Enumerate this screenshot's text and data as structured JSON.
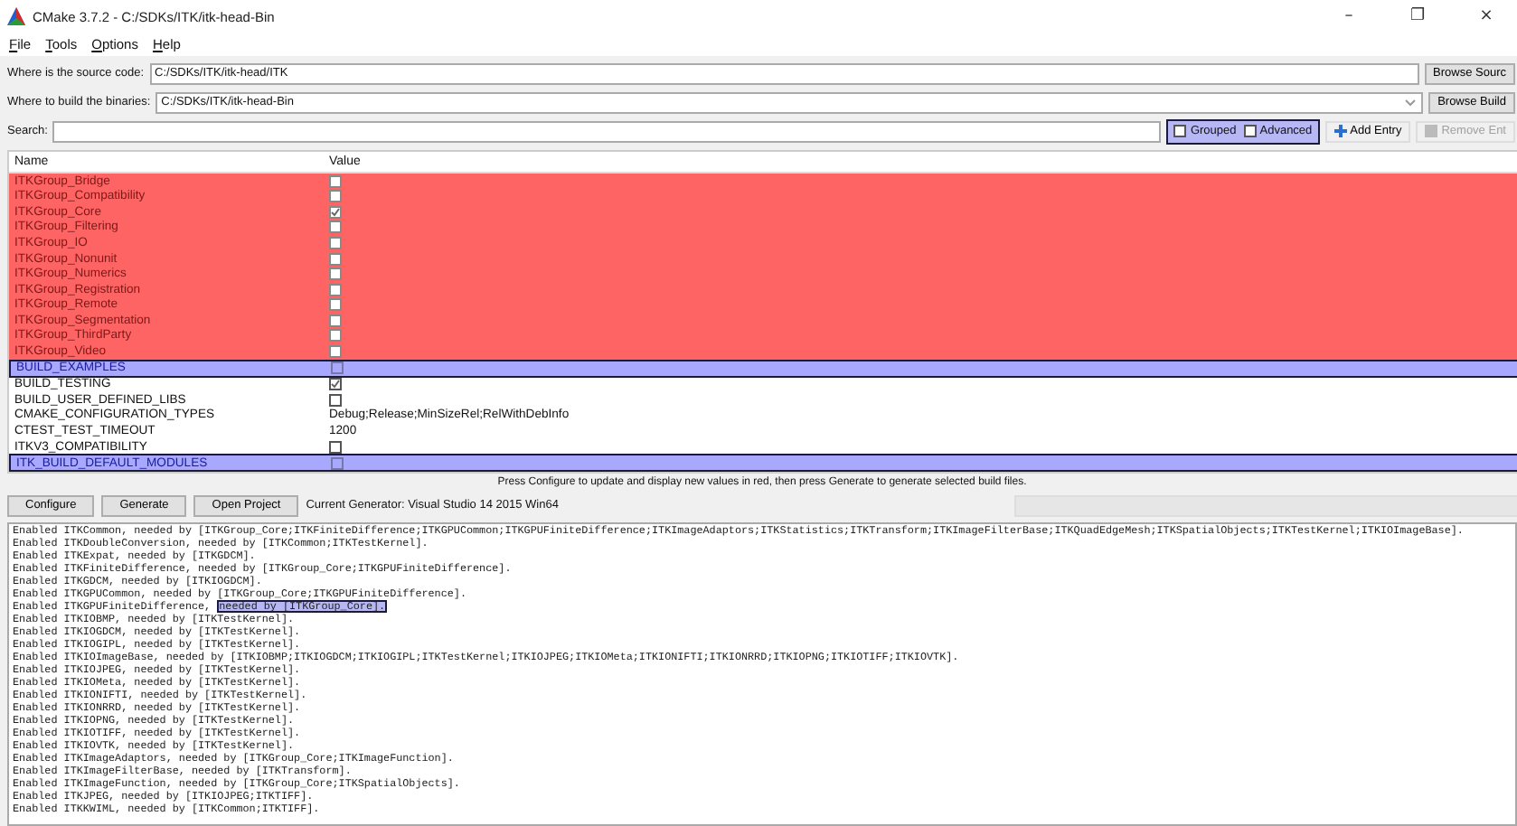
{
  "window": {
    "title": "CMake 3.7.2 - C:/SDKs/ITK/itk-head-Bin",
    "controls": [
      "–",
      "❐",
      "×"
    ]
  },
  "menu": [
    "File",
    "Tools",
    "Options",
    "Help"
  ],
  "source": {
    "label": "Where is the source code:",
    "value": "C:/SDKs/ITK/itk-head/ITK",
    "button": "Browse Sourc"
  },
  "binaries": {
    "label": "Where to build the binaries:",
    "value": "C:/SDKs/ITK/itk-head-Bin",
    "button": "Browse Build"
  },
  "search": {
    "label": "Search:",
    "grouped": {
      "label": "Grouped",
      "checked": false
    },
    "advanced": {
      "label": "Advanced",
      "checked": false
    },
    "add_entry": "Add Entry",
    "remove_entry": {
      "label": "Remove Ent",
      "disabled": true
    }
  },
  "table": {
    "columns": [
      "Name",
      "Value"
    ],
    "rows": [
      {
        "name": "ITKGroup_Bridge",
        "kind": "bool",
        "checked": false,
        "changed": true,
        "selected": false
      },
      {
        "name": "ITKGroup_Compatibility",
        "kind": "bool",
        "checked": false,
        "changed": true,
        "selected": false
      },
      {
        "name": "ITKGroup_Core",
        "kind": "bool",
        "checked": true,
        "changed": true,
        "selected": false
      },
      {
        "name": "ITKGroup_Filtering",
        "kind": "bool",
        "checked": false,
        "changed": true,
        "selected": false
      },
      {
        "name": "ITKGroup_IO",
        "kind": "bool",
        "checked": false,
        "changed": true,
        "selected": false
      },
      {
        "name": "ITKGroup_Nonunit",
        "kind": "bool",
        "checked": false,
        "changed": true,
        "selected": false
      },
      {
        "name": "ITKGroup_Numerics",
        "kind": "bool",
        "checked": false,
        "changed": true,
        "selected": false
      },
      {
        "name": "ITKGroup_Registration",
        "kind": "bool",
        "checked": false,
        "changed": true,
        "selected": false
      },
      {
        "name": "ITKGroup_Remote",
        "kind": "bool",
        "checked": false,
        "changed": true,
        "selected": false
      },
      {
        "name": "ITKGroup_Segmentation",
        "kind": "bool",
        "checked": false,
        "changed": true,
        "selected": false
      },
      {
        "name": "ITKGroup_ThirdParty",
        "kind": "bool",
        "checked": false,
        "changed": true,
        "selected": false
      },
      {
        "name": "ITKGroup_Video",
        "kind": "bool",
        "checked": false,
        "changed": true,
        "selected": false
      },
      {
        "name": "BUILD_EXAMPLES",
        "kind": "bool",
        "checked": false,
        "changed": false,
        "selected": true
      },
      {
        "name": "BUILD_TESTING",
        "kind": "bool",
        "checked": true,
        "changed": false,
        "selected": false
      },
      {
        "name": "BUILD_USER_DEFINED_LIBS",
        "kind": "bool",
        "checked": false,
        "changed": false,
        "selected": false
      },
      {
        "name": "CMAKE_CONFIGURATION_TYPES",
        "kind": "text",
        "value": "Debug;Release;MinSizeRel;RelWithDebInfo",
        "changed": false,
        "selected": false
      },
      {
        "name": "CTEST_TEST_TIMEOUT",
        "kind": "text",
        "value": "1200",
        "changed": false,
        "selected": false
      },
      {
        "name": "ITKV3_COMPATIBILITY",
        "kind": "bool",
        "checked": false,
        "changed": false,
        "selected": false
      },
      {
        "name": "ITK_BUILD_DEFAULT_MODULES",
        "kind": "bool",
        "checked": false,
        "changed": false,
        "selected": true
      }
    ]
  },
  "status": "Press Configure to update and display new values in red, then press Generate to generate selected build files.",
  "progress": {
    "level": 0
  },
  "buttons": [
    "Configure",
    "Generate",
    "Open Project"
  ],
  "generator": "Current Generator: Visual Studio 14 2015 Win64",
  "log": [
    {
      "text": "Enabled ITKCommon, needed by [ITKGroup_Core;ITKFiniteDifference;ITKGPUCommon;ITKGPUFiniteDifference;ITKImageAdaptors;ITKStatistics;ITKTransform;ITKImageFilterBase;ITKQuadEdgeMesh;ITKSpatialObjects;ITKTestKernel;ITKIOImageBase]."
    },
    {
      "text": "Enabled ITKDoubleConversion, needed by [ITKCommon;ITKTestKernel]."
    },
    {
      "text": "Enabled ITKExpat, needed by [ITKGDCM]."
    },
    {
      "text": "Enabled ITKFiniteDifference, needed by [ITKGroup_Core;ITKGPUFiniteDifference]."
    },
    {
      "text": "Enabled ITKGDCM, needed by [ITKIOGDCM]."
    },
    {
      "text": "Enabled ITKGPUCommon, needed by [ITKGroup_Core;ITKGPUFiniteDifference]."
    },
    {
      "text": "Enabled ITKGPUFiniteDifference,",
      "highlight": "needed by [ITKGroup_Core]."
    },
    {
      "text": "Enabled ITKIOBMP, needed by [ITKTestKernel]."
    },
    {
      "text": "Enabled ITKIOGDCM, needed by [ITKTestKernel]."
    },
    {
      "text": "Enabled ITKIOGIPL, needed by [ITKTestKernel]."
    },
    {
      "text": "Enabled ITKIOImageBase, needed by [ITKIOBMP;ITKIOGDCM;ITKIOGIPL;ITKTestKernel;ITKIOJPEG;ITKIOMeta;ITKIONIFTI;ITKIONRRD;ITKIOPNG;ITKIOTIFF;ITKIOVTK]."
    },
    {
      "text": "Enabled ITKIOJPEG, needed by [ITKTestKernel]."
    },
    {
      "text": "Enabled ITKIOMeta, needed by [ITKTestKernel]."
    },
    {
      "text": "Enabled ITKIONIFTI, needed by [ITKTestKernel]."
    },
    {
      "text": "Enabled ITKIONRRD, needed by [ITKTestKernel]."
    },
    {
      "text": "Enabled ITKIOPNG, needed by [ITKTestKernel]."
    },
    {
      "text": "Enabled ITKIOTIFF, needed by [ITKTestKernel]."
    },
    {
      "text": "Enabled ITKIOVTK, needed by [ITKTestKernel]."
    },
    {
      "text": "Enabled ITKImageAdaptors, needed by [ITKGroup_Core;ITKImageFunction]."
    },
    {
      "text": "Enabled ITKImageFilterBase, needed by [ITKTransform]."
    },
    {
      "text": "Enabled ITKImageFunction, needed by [ITKGroup_Core;ITKSpatialObjects]."
    },
    {
      "text": "Enabled ITKJPEG, needed by [ITKIOJPEG;ITKTIFF]."
    },
    {
      "text": "Enabled ITKKWIML, needed by [ITKCommon;ITKTIFF]."
    }
  ]
}
